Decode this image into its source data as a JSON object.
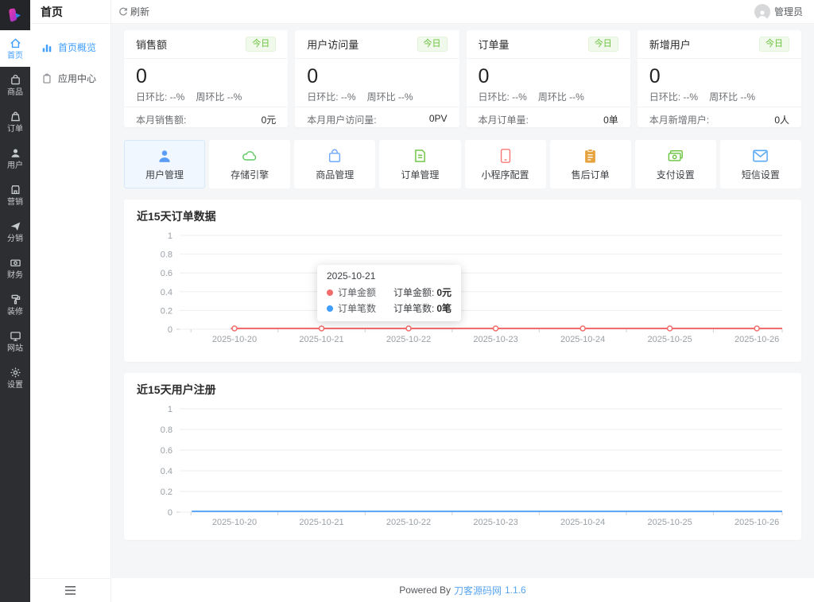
{
  "colors": {
    "accent_blue": "#409eff",
    "success_green": "#67c23a",
    "order_line_red": "#f56c6c",
    "register_line_blue": "#5ca8f6"
  },
  "rail": {
    "items": [
      {
        "label": "首页",
        "icon": "home-icon",
        "active": true
      },
      {
        "label": "商品",
        "icon": "goods-icon",
        "active": false
      },
      {
        "label": "订单",
        "icon": "order-icon",
        "active": false
      },
      {
        "label": "用户",
        "icon": "user-icon",
        "active": false
      },
      {
        "label": "营销",
        "icon": "marketing-icon",
        "active": false
      },
      {
        "label": "分销",
        "icon": "distribution-icon",
        "active": false
      },
      {
        "label": "财务",
        "icon": "finance-icon",
        "active": false
      },
      {
        "label": "装修",
        "icon": "decorate-icon",
        "active": false
      },
      {
        "label": "网站",
        "icon": "website-icon",
        "active": false
      },
      {
        "label": "设置",
        "icon": "settings-icon",
        "active": false
      }
    ]
  },
  "submenu": {
    "title": "首页",
    "items": [
      {
        "label": "首页概览",
        "icon": "bar-chart-icon",
        "active": true
      },
      {
        "label": "应用中心",
        "icon": "app-center-icon",
        "active": false
      }
    ]
  },
  "topbar": {
    "refresh_label": "刷新",
    "user_name": "管理员"
  },
  "stats": [
    {
      "title": "销售额",
      "badge": "今日",
      "value": "0",
      "day_ratio": "日环比: --%",
      "week_ratio": "周环比 --%",
      "footer_label": "本月销售额:",
      "footer_value": "0元"
    },
    {
      "title": "用户访问量",
      "badge": "今日",
      "value": "0",
      "day_ratio": "日环比: --%",
      "week_ratio": "周环比 --%",
      "footer_label": "本月用户访问量:",
      "footer_value": "0PV"
    },
    {
      "title": "订单量",
      "badge": "今日",
      "value": "0",
      "day_ratio": "日环比: --%",
      "week_ratio": "周环比 --%",
      "footer_label": "本月订单量:",
      "footer_value": "0单"
    },
    {
      "title": "新增用户",
      "badge": "今日",
      "value": "0",
      "day_ratio": "日环比: --%",
      "week_ratio": "周环比 --%",
      "footer_label": "本月新增用户:",
      "footer_value": "0人"
    }
  ],
  "quick_actions": [
    {
      "label": "用户管理",
      "icon": "user-manage-icon",
      "color": "#5b9df6",
      "active": true
    },
    {
      "label": "存储引擎",
      "icon": "cloud-storage-icon",
      "color": "#5ecc62",
      "active": false
    },
    {
      "label": "商品管理",
      "icon": "goods-bag-icon",
      "color": "#6fa8f8",
      "active": false
    },
    {
      "label": "订单管理",
      "icon": "order-doc-icon",
      "color": "#67c23a",
      "active": false
    },
    {
      "label": "小程序配置",
      "icon": "miniapp-phone-icon",
      "color": "#f87979",
      "active": false
    },
    {
      "label": "售后订单",
      "icon": "aftersale-clipboard-icon",
      "color": "#e6a23c",
      "active": false
    },
    {
      "label": "支付设置",
      "icon": "payment-money-icon",
      "color": "#67c23a",
      "active": false
    },
    {
      "label": "短信设置",
      "icon": "sms-mail-icon",
      "color": "#5aa9f5",
      "active": false
    }
  ],
  "chart_data": [
    {
      "type": "line",
      "title": "近15天订单数据",
      "categories": [
        "2025-10-20",
        "2025-10-21",
        "2025-10-22",
        "2025-10-23",
        "2025-10-24",
        "2025-10-25",
        "2025-10-26"
      ],
      "series": [
        {
          "name": "订单金额",
          "values": [
            0,
            0,
            0,
            0,
            0,
            0,
            0
          ],
          "color": "#f56c6c"
        },
        {
          "name": "订单笔数",
          "values": [
            0,
            0,
            0,
            0,
            0,
            0,
            0
          ],
          "color": "#409eff"
        }
      ],
      "ylim": [
        0,
        1
      ],
      "yticks": [
        0,
        0.2,
        0.4,
        0.6,
        0.8,
        1
      ],
      "grid": true,
      "legend": "hidden",
      "tooltip": {
        "title": "2025-10-21",
        "rows": [
          {
            "name": "订单金额",
            "value_label": "订单金额:",
            "value": "0元"
          },
          {
            "name": "订单笔数",
            "value_label": "订单笔数:",
            "value": "0笔"
          }
        ]
      }
    },
    {
      "type": "line",
      "title": "近15天用户注册",
      "categories": [
        "2025-10-20",
        "2025-10-21",
        "2025-10-22",
        "2025-10-23",
        "2025-10-24",
        "2025-10-25",
        "2025-10-26"
      ],
      "series": [
        {
          "name": "用户注册",
          "values": [
            0,
            0,
            0,
            0,
            0,
            0,
            0
          ],
          "color": "#5ca8f6"
        }
      ],
      "ylim": [
        0,
        1
      ],
      "yticks": [
        0,
        0.2,
        0.4,
        0.6,
        0.8,
        1
      ],
      "grid": true,
      "legend": "hidden"
    }
  ],
  "footer": {
    "powered": "Powered By",
    "brand": "刀客源码网",
    "version": "1.1.6"
  }
}
